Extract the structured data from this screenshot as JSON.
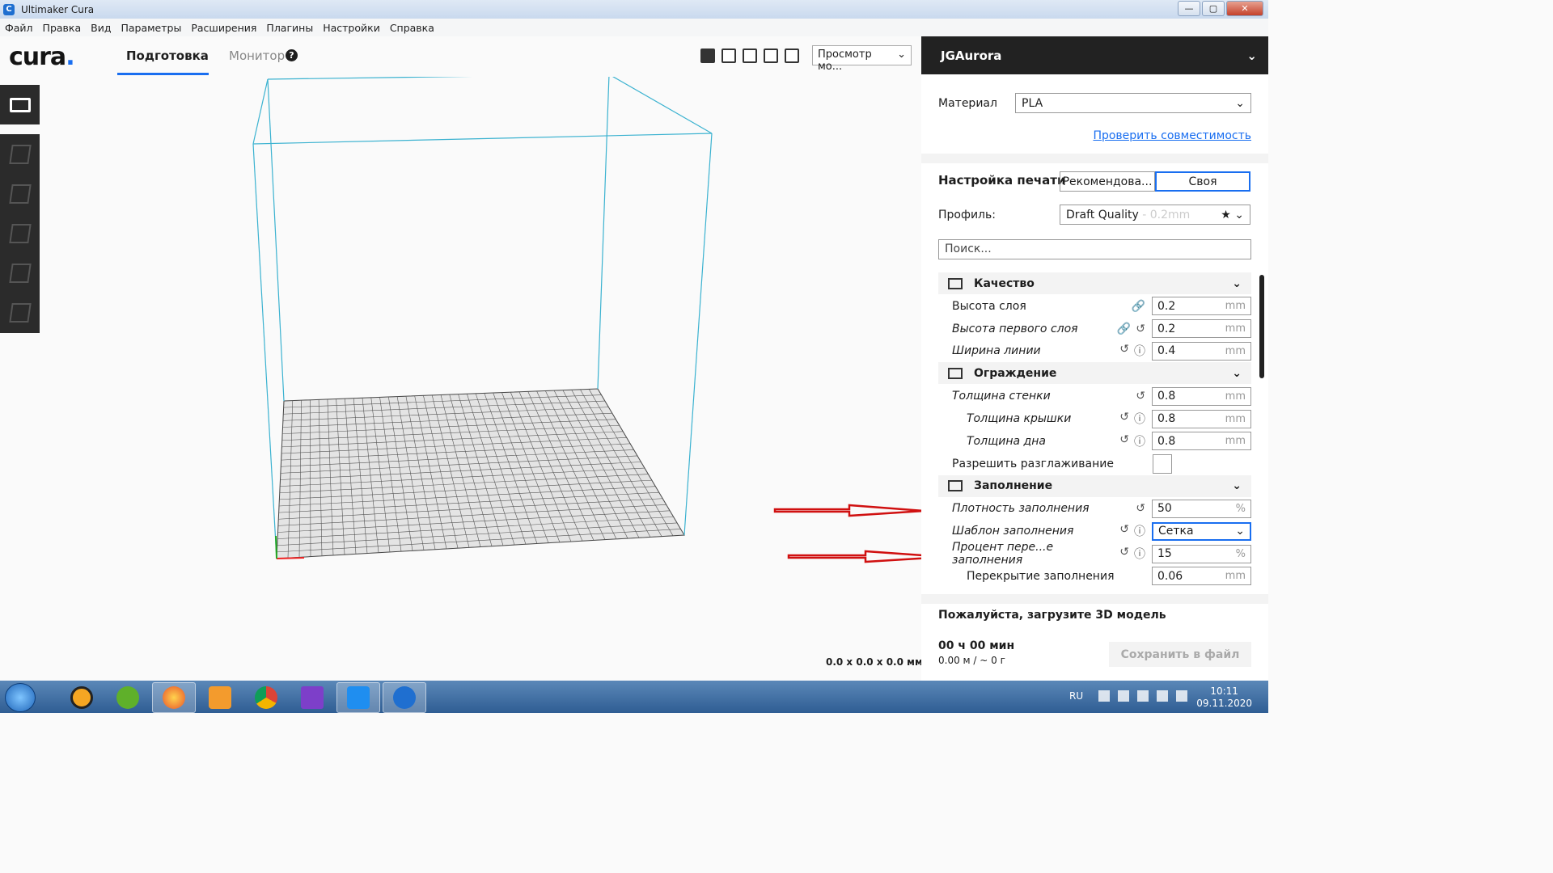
{
  "window": {
    "title": "Ultimaker Cura",
    "minimize": "—",
    "maximize": "▢",
    "close": "✕"
  },
  "menu": [
    "Файл",
    "Правка",
    "Вид",
    "Параметры",
    "Расширения",
    "Плагины",
    "Настройки",
    "Справка"
  ],
  "topbar": {
    "logo": "cura",
    "tab_prepare": "Подготовка",
    "tab_monitor": "Монитор",
    "view_select": "Просмотр мо..."
  },
  "viewport": {
    "dimensions": "0.0 x 0.0 x 0.0 мм"
  },
  "panel": {
    "printer": "JGAurora",
    "material_label": "Материал",
    "material_value": "PLA",
    "compat_link": "Проверить совместимость",
    "print_setup_title": "Настройка печати",
    "mode_recommended": "Рекомендова...",
    "mode_custom": "Своя",
    "profile_label": "Профиль:",
    "profile_value": "Draft Quality",
    "profile_dim": " - 0.2mm",
    "search_placeholder": "Поиск..."
  },
  "settings": {
    "quality": {
      "title": "Качество",
      "rows": [
        {
          "name": "Высота слоя",
          "value": "0.2",
          "unit": "mm"
        },
        {
          "name": "Высота первого слоя",
          "value": "0.2",
          "unit": "mm"
        },
        {
          "name": "Ширина линии",
          "value": "0.4",
          "unit": "mm"
        }
      ]
    },
    "walls": {
      "title": "Ограждение",
      "rows": [
        {
          "name": "Толщина стенки",
          "value": "0.8",
          "unit": "mm"
        },
        {
          "name": "Толщина крышки",
          "value": "0.8",
          "unit": "mm"
        },
        {
          "name": "Толщина дна",
          "value": "0.8",
          "unit": "mm"
        },
        {
          "name": "Разрешить разглаживание"
        }
      ]
    },
    "infill": {
      "title": "Заполнение",
      "rows": [
        {
          "name": "Плотность заполнения",
          "value": "50",
          "unit": "%"
        },
        {
          "name": "Шаблон заполнения",
          "value": "Сетка"
        },
        {
          "name": "Процент пере...е заполнения",
          "value": "15",
          "unit": "%"
        },
        {
          "name": "Перекрытие заполнения",
          "value": "0.06",
          "unit": "mm"
        }
      ]
    }
  },
  "footer": {
    "load_message": "Пожалуйста, загрузите 3D модель",
    "time": "00 ч 00 мин",
    "material_use": "0.00 м / ~ 0 г",
    "save_button": "Сохранить в файл"
  },
  "taskbar": {
    "lang": "RU",
    "time": "10:11",
    "date": "09.11.2020"
  },
  "colors": {
    "accent": "#196ef0",
    "dark": "#222222",
    "grid_outline": "#3bb2d0",
    "annotation_arrow": "#d01010"
  }
}
